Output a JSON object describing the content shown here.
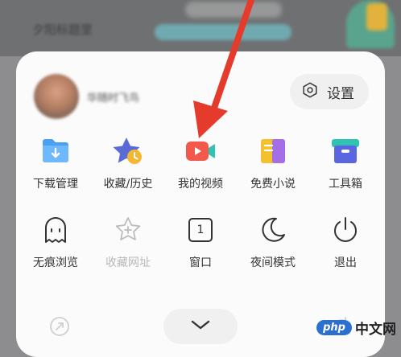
{
  "background": {
    "title_text": "夕阳标题里"
  },
  "header": {
    "username": "华随时飞鸟",
    "settings_label": "设置"
  },
  "menu": {
    "row1": [
      {
        "label": "下载管理",
        "icon": "download-folder-icon",
        "color": "#4aa0f3"
      },
      {
        "label": "收藏/历史",
        "icon": "star-clock-icon",
        "color": "#5b6bd6"
      },
      {
        "label": "我的视频",
        "icon": "video-camera-icon",
        "color": "#f3594b"
      },
      {
        "label": "免费小说",
        "icon": "book-icon",
        "color": "#f4c12e"
      },
      {
        "label": "工具箱",
        "icon": "toolbox-icon",
        "color": "#5966e0"
      }
    ],
    "row2": [
      {
        "label": "无痕浏览",
        "icon": "ghost-icon"
      },
      {
        "label": "收藏网址",
        "icon": "star-plus-icon",
        "disabled": true
      },
      {
        "label": "窗口",
        "icon": "window-count-icon",
        "badge": "1"
      },
      {
        "label": "夜间模式",
        "icon": "moon-icon"
      },
      {
        "label": "退出",
        "icon": "power-icon"
      }
    ]
  },
  "watermark": {
    "logo_text": "php",
    "site_text": "中文网"
  },
  "colors": {
    "arrow": "#e53b2c",
    "panel": "#fbfbfb"
  }
}
